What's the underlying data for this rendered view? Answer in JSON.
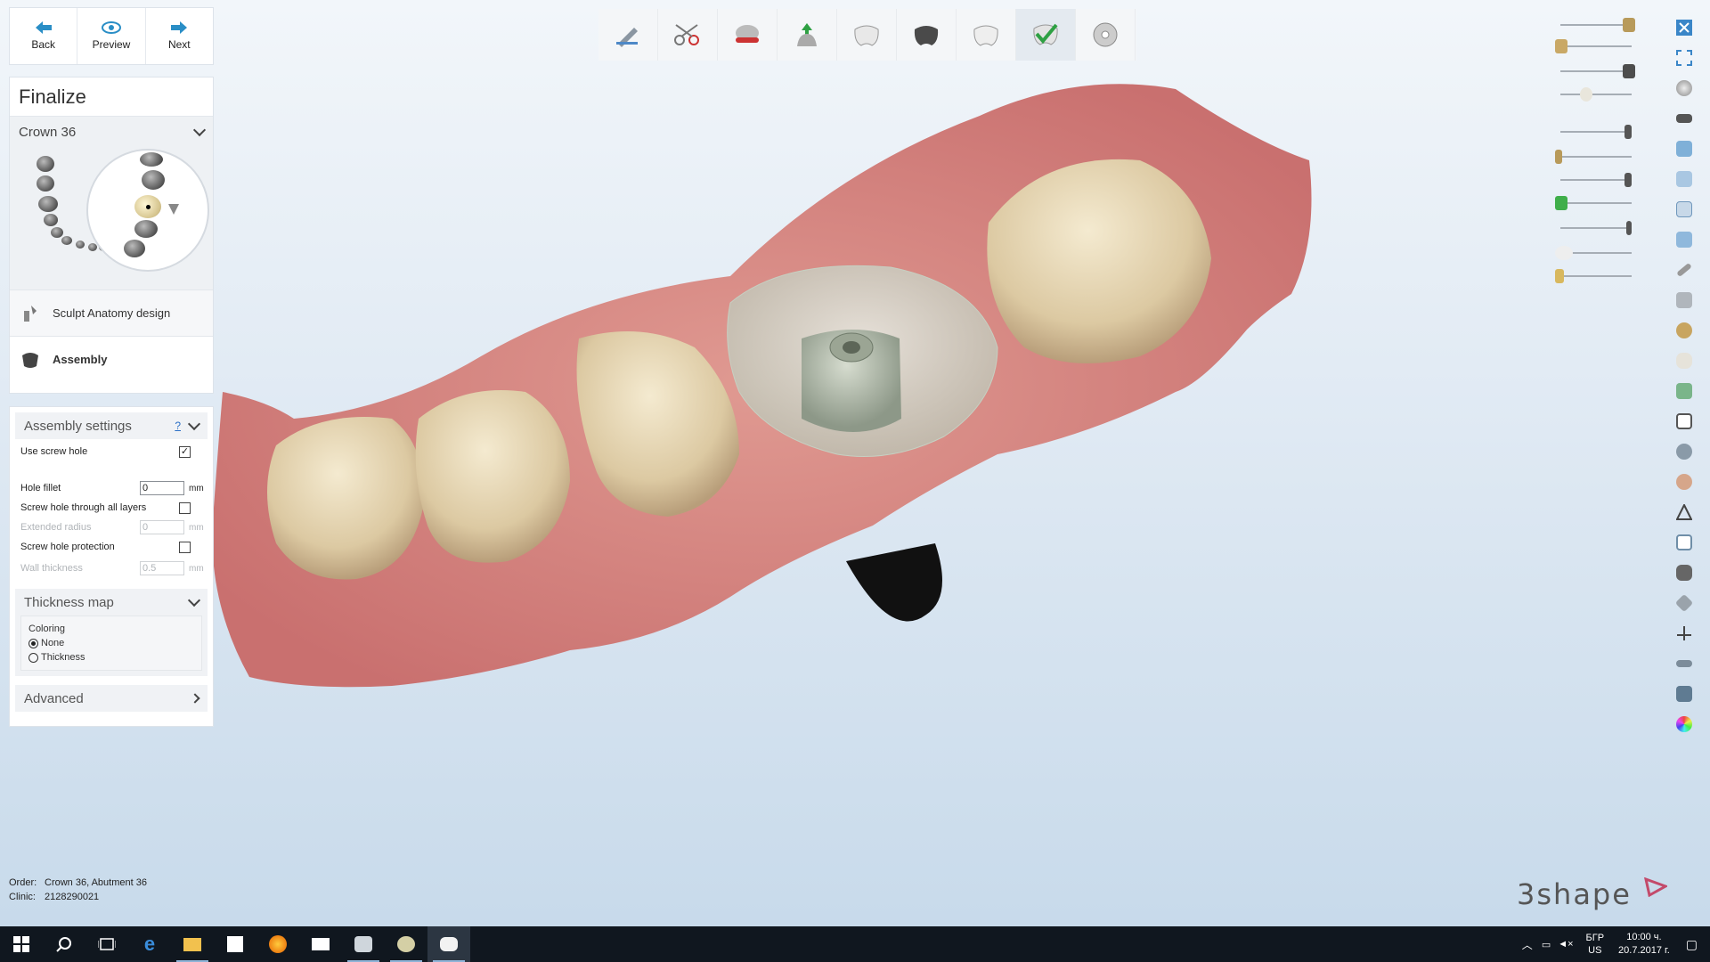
{
  "nav": {
    "back": "Back",
    "preview": "Preview",
    "next": "Next"
  },
  "panel": {
    "title": "Finalize",
    "selection": "Crown 36",
    "steps": [
      {
        "label": "Sculpt Anatomy design"
      },
      {
        "label": "Assembly"
      }
    ]
  },
  "assembly_settings": {
    "title": "Assembly settings",
    "help": "?",
    "use_screw_hole": "Use screw hole",
    "use_screw_hole_checked": "✓",
    "hole_fillet": "Hole fillet",
    "hole_fillet_value": "0",
    "hole_fillet_unit": "mm",
    "through_all_layers": "Screw hole through all layers",
    "extended_radius": "Extended radius",
    "extended_radius_value": "0",
    "extended_radius_unit": "mm",
    "screw_hole_protection": "Screw hole protection",
    "wall_thickness": "Wall thickness",
    "wall_thickness_value": "0.5",
    "wall_thickness_unit": "mm"
  },
  "thickness_map": {
    "title": "Thickness map",
    "coloring_label": "Coloring",
    "options": [
      "None",
      "Thickness"
    ],
    "selected": "None"
  },
  "advanced": {
    "title": "Advanced"
  },
  "order": {
    "order_label": "Order:",
    "order_value": "Crown 36, Abutment 36",
    "clinic_label": "Clinic:",
    "clinic_value": "2128290021"
  },
  "logo": "3shape",
  "taskbar": {
    "lang_top": "БГР",
    "lang_bottom": "US",
    "time": "10:00 ч.",
    "date": "20.7.2017 г."
  },
  "colors": {
    "nav_arrow": "#2a8ec6",
    "gingiva": "#d98a86",
    "tooth": "#eadfc6",
    "slider_bronze": "#b89a5a",
    "slider_green": "#3fae4a",
    "taskbar": "#10171f"
  },
  "icons": {
    "back": "arrow-left-icon",
    "preview": "eye-icon",
    "next": "arrow-right-icon",
    "close": "close-icon",
    "fullscreen": "fullscreen-icon"
  }
}
